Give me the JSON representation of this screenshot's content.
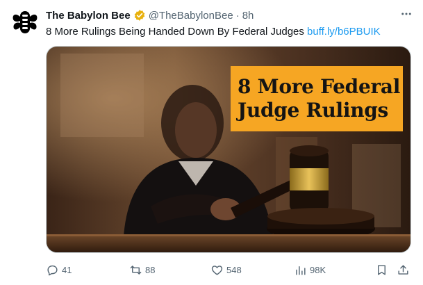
{
  "author": {
    "name": "The Babylon Bee",
    "handle": "@TheBabylonBee",
    "separator": "·",
    "time": "8h",
    "avatar_color": "#000000",
    "verified_color": "#e8b10e"
  },
  "tweet": {
    "text": "8 More Rulings Being Handed Down By Federal Judges",
    "link_text": "buff.ly/b6PBUIK",
    "link_color": "#1d9bf0"
  },
  "media": {
    "banner_line1": "8 More Federal",
    "banner_line2": "Judge Rulings",
    "banner_color": "#f6a623"
  },
  "actions": {
    "replies": "41",
    "reposts": "88",
    "likes": "548",
    "views": "98K"
  },
  "icons": [
    "bee-logo-icon",
    "verified-badge-icon",
    "more-icon",
    "reply-icon",
    "repost-icon",
    "like-icon",
    "views-icon",
    "bookmark-icon",
    "share-icon"
  ]
}
